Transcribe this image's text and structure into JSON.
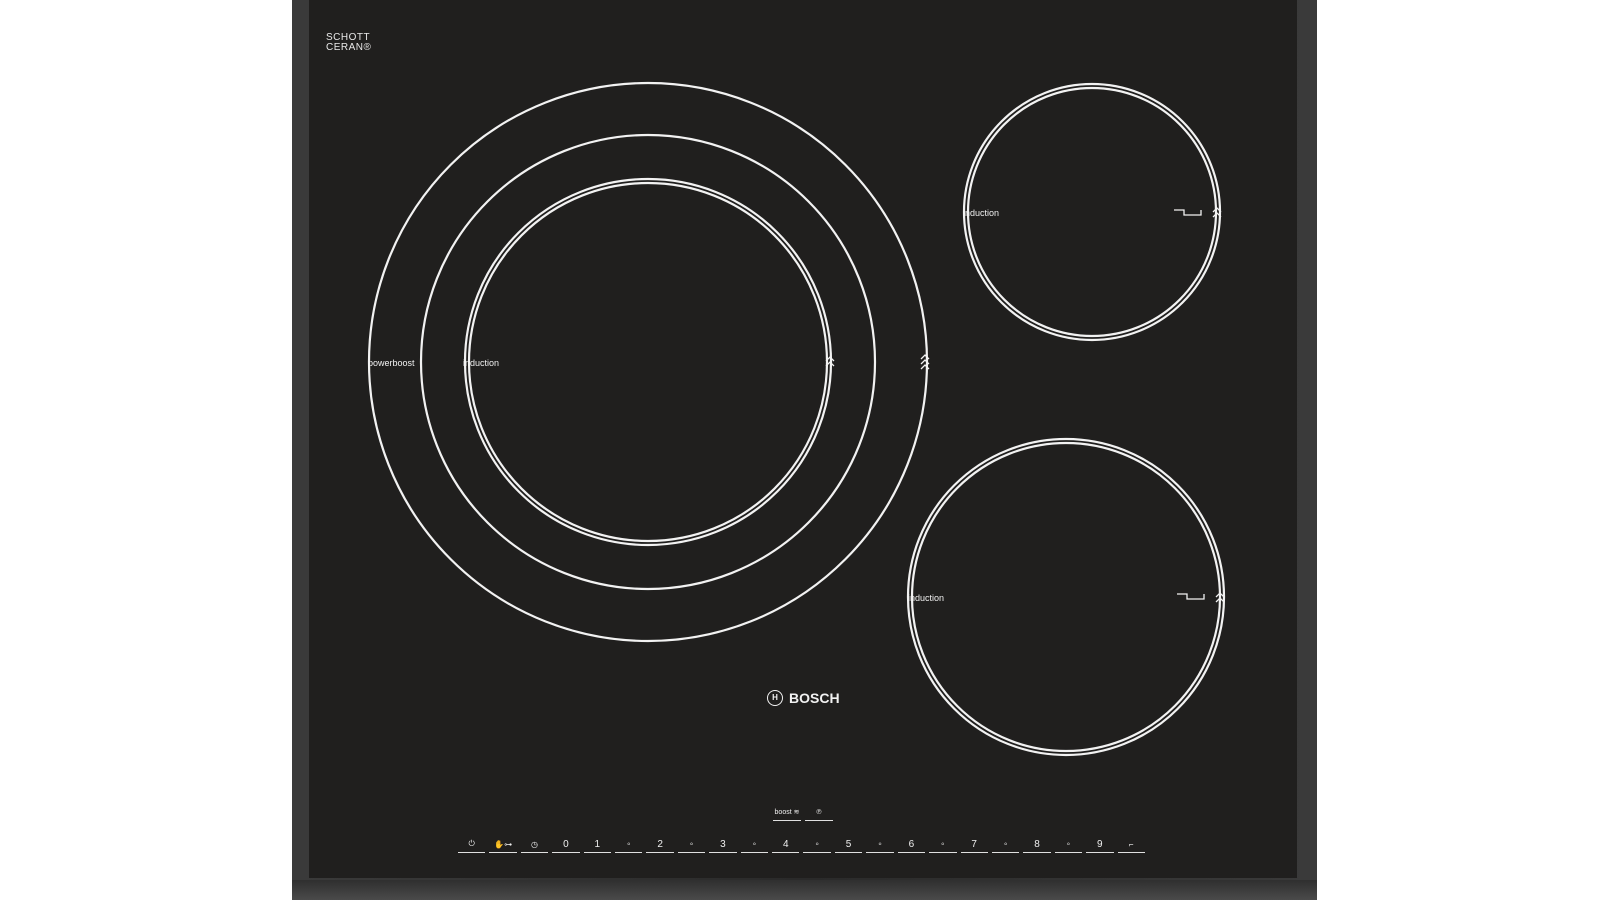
{
  "brand": {
    "name": "BOSCH",
    "symbol": "H"
  },
  "glass_brand": {
    "line1": "SCHOTT",
    "line2": "CERAN®"
  },
  "zones": {
    "large_outer_label": "powerboost",
    "large_inner_label": "induction",
    "top_right_label": "induction",
    "bottom_right_label": "induction"
  },
  "controls": {
    "top_keys": [
      "boost ≋",
      "℗"
    ],
    "bottom_keys": [
      "⏻",
      "✋⊶",
      "◷",
      "0",
      "1",
      "◦",
      "2",
      "◦",
      "3",
      "◦",
      "4",
      "◦",
      "5",
      "◦",
      "6",
      "◦",
      "7",
      "◦",
      "8",
      "◦",
      "9",
      "⌐"
    ]
  },
  "colors": {
    "glass": "#201f1e",
    "line": "#f2f2f2",
    "frame": "#333333"
  }
}
